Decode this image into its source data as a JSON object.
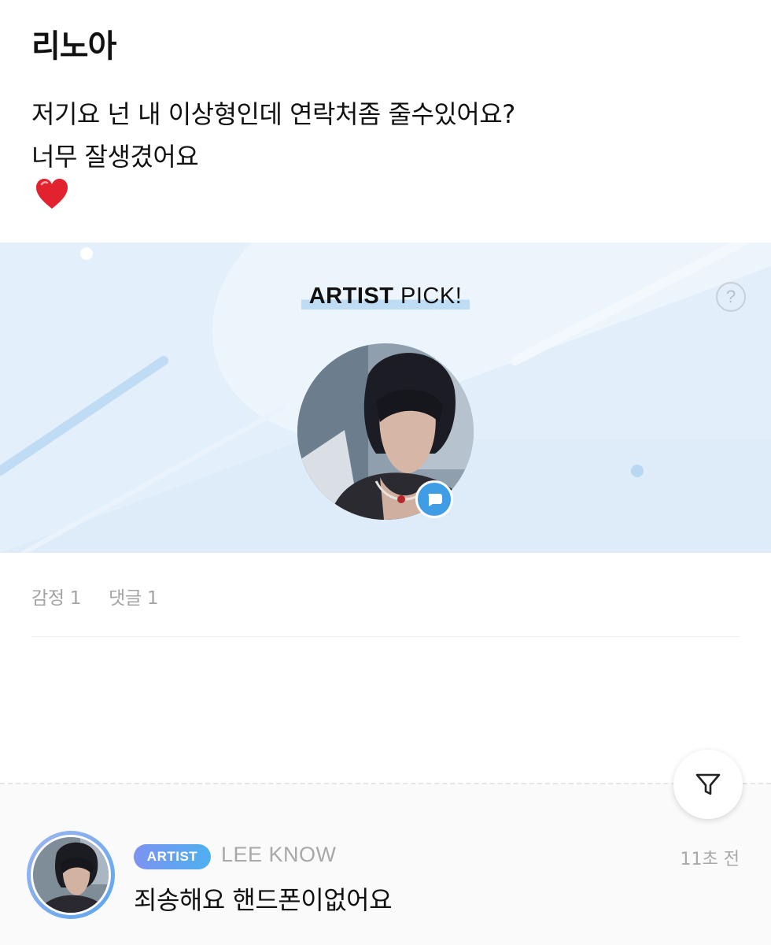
{
  "post": {
    "author": "리노아",
    "lines": [
      "저기요 넌 내 이상형인데 연락처좀 줄수있어요?",
      "너무 잘생겼어요"
    ],
    "emoji": "heart-icon"
  },
  "artist_pick": {
    "title_bold": "ARTIST",
    "title_rest": "PICK!",
    "help": "?",
    "accent_color": "#3f9de6",
    "banner_color": "#e3f0fb"
  },
  "counts": {
    "emotion": "감정 1",
    "comments": "댓글 1"
  },
  "comment": {
    "badge": "ARTIST",
    "name": "LEE KNOW",
    "time": "11초 전",
    "text": "죄송해요 핸드폰이없어요"
  }
}
